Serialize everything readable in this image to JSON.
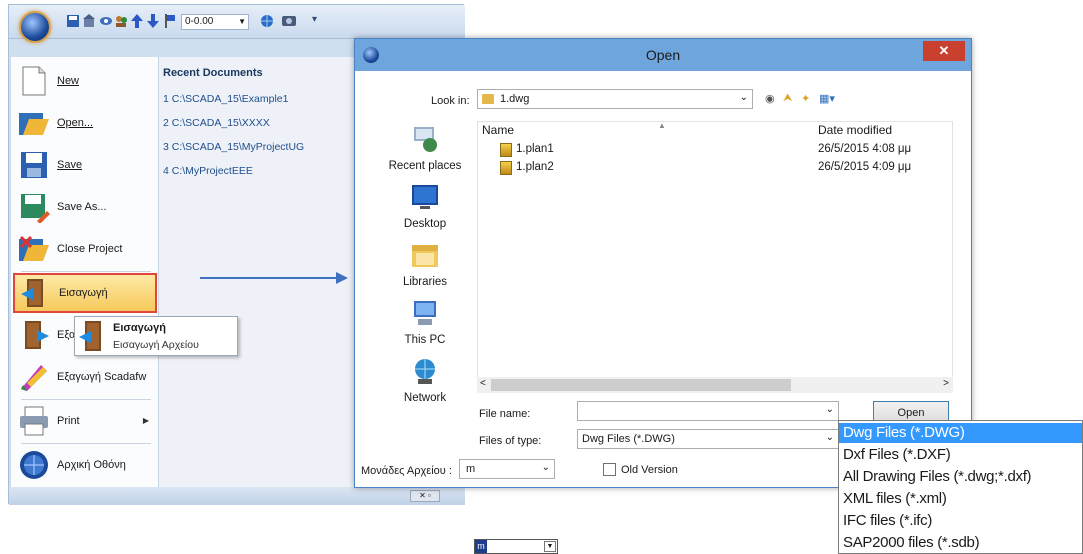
{
  "quick_access": {
    "zoom_value": "0-0.00",
    "more_label": "▾"
  },
  "menu": {
    "items": [
      {
        "label": "New"
      },
      {
        "label": "Open..."
      },
      {
        "label": "Save"
      },
      {
        "label": "Save As..."
      },
      {
        "label": "Close Project"
      },
      {
        "label": "Εισαγωγή"
      },
      {
        "label": "Εξαγ"
      },
      {
        "label": "Εξαγωγή Scadafw"
      },
      {
        "label": "Print"
      },
      {
        "label": "Αρχική Οθόνη"
      }
    ],
    "recent_title": "Recent Documents",
    "recent": [
      "1 C:\\SCADA_15\\Example1",
      "2 C:\\SCADA_15\\XXXX",
      "3 C:\\SCADA_15\\MyProjectUG",
      "4 C:\\MyProjectEEE"
    ],
    "tooltip": {
      "title": "Εισαγωγή",
      "description": "Εισαγωγή Αρχείου"
    }
  },
  "dialog": {
    "title": "Open",
    "close_label": "✕",
    "look_in_label": "Look in:",
    "look_in_value": "1.dwg",
    "places": [
      "Recent places",
      "Desktop",
      "Libraries",
      "This PC",
      "Network"
    ],
    "columns": {
      "name": "Name",
      "date": "Date modified"
    },
    "files": [
      {
        "name": "1.plan1",
        "date": "26/5/2015 4:08 μμ"
      },
      {
        "name": "1.plan2",
        "date": "26/5/2015 4:09 μμ"
      }
    ],
    "file_name_label": "File name:",
    "file_name_value": "",
    "open_button": "Open",
    "file_type_label": "Files of type:",
    "file_type_value": "Dwg Files (*.DWG)",
    "units_label": "Μονάδες Αρχείου :",
    "units_value": "m",
    "old_version_label": "Old Version"
  },
  "file_type_options": [
    "Dwg Files (*.DWG)",
    "Dxf Files (*.DXF)",
    "All Drawing Files (*.dwg;*.dxf)",
    "XML files (*.xml)",
    "IFC files (*.ifc)",
    "SAP2000 files (*.sdb)"
  ],
  "mini_select": {
    "value": "m"
  },
  "colors": {
    "accent": "#3399ff",
    "title_bar": "#6ea5dd",
    "close": "#c9402f",
    "highlight_border": "#e0463a"
  }
}
